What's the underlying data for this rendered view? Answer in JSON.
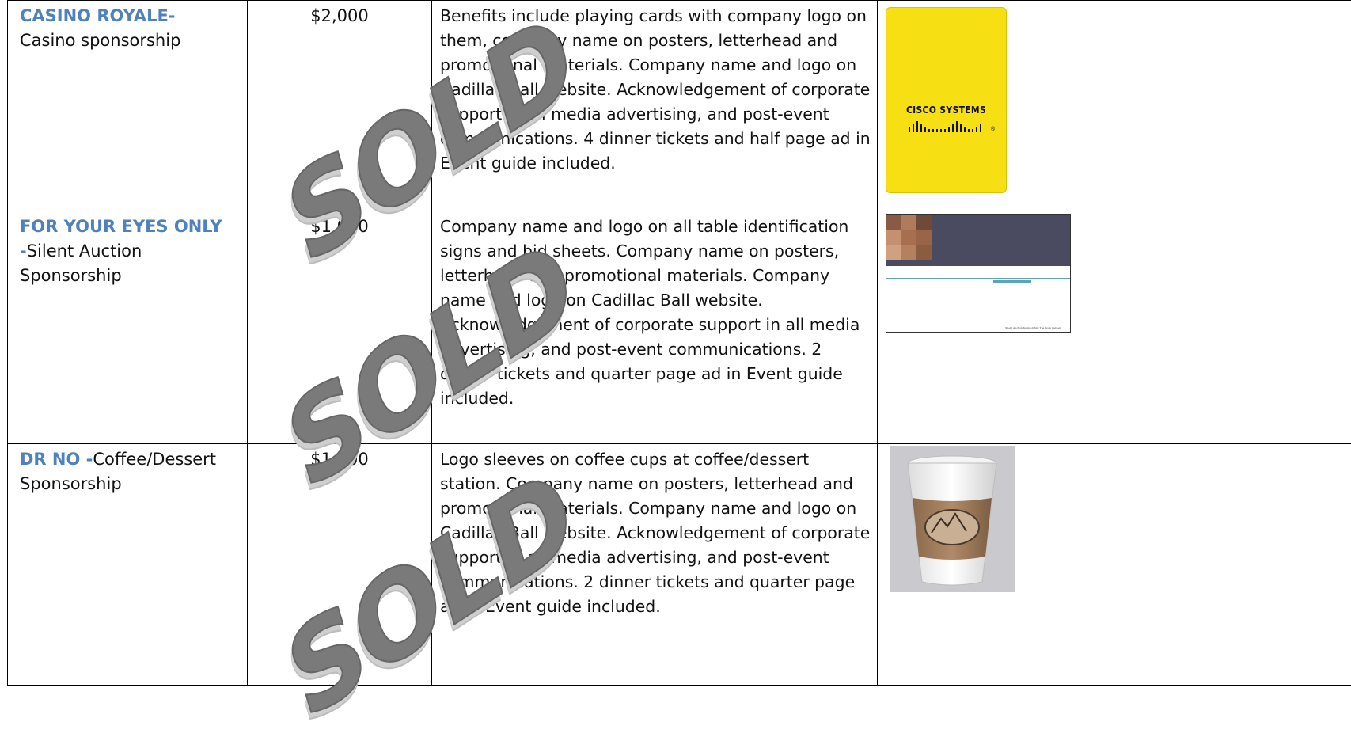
{
  "sponsorships": [
    {
      "name": "CASINO ROYALE-",
      "subtitle": "Casino sponsorship",
      "price": "$2,000",
      "description": "Benefits include playing cards with company logo on them, company name on posters, letterhead and promotional materials. Company name and logo on Cadillac Ball website. Acknowledgement of corporate support in all media advertising, and post-event communications. 4 dinner tickets and half page ad in Event guide included.",
      "image": {
        "brand": "Cisco Systems",
        "brand_text": "CISCO SYSTEMS",
        "reg": "®",
        "colors": {
          "card": "#f6e013"
        }
      }
    },
    {
      "name": "FOR YOUR EYES ONLY",
      "dash": "-",
      "subtitle": "Silent Auction Sponsorship",
      "price": "$1,000",
      "description": "Company name and logo on all table identification signs and bid sheets. Company name on posters, letterhead and promotional materials. Company name and logo on Cadillac Ball website. Acknowledgement of corporate support in all media advertising, and post-event communications. 2 dinner tickets and quarter page ad in Event guide included.",
      "image": {
        "title": "TABLE 1 CLOSES AT 8:00 PM",
        "caption": "Silent Auction Sponsorship: The Rock Garden"
      }
    },
    {
      "name": "DR NO -",
      "subtitle": "Coffee/Dessert Sponsorship",
      "price": "$1,000",
      "description": "Logo sleeves on coffee cups at coffee/dessert station. Company name on posters, letterhead and promotional materials. Company name and logo on Cadillac Ball website. Acknowledgement of corporate support in all media advertising, and post-event communications. 2 dinner tickets and quarter page ad in Event guide included.",
      "image": {
        "subject": "coffee-cup-with-logo-sleeve"
      }
    }
  ],
  "watermark": "SOLD",
  "colors": {
    "title_blue": "#4f81bd",
    "watermark": "#7a7a7a"
  }
}
